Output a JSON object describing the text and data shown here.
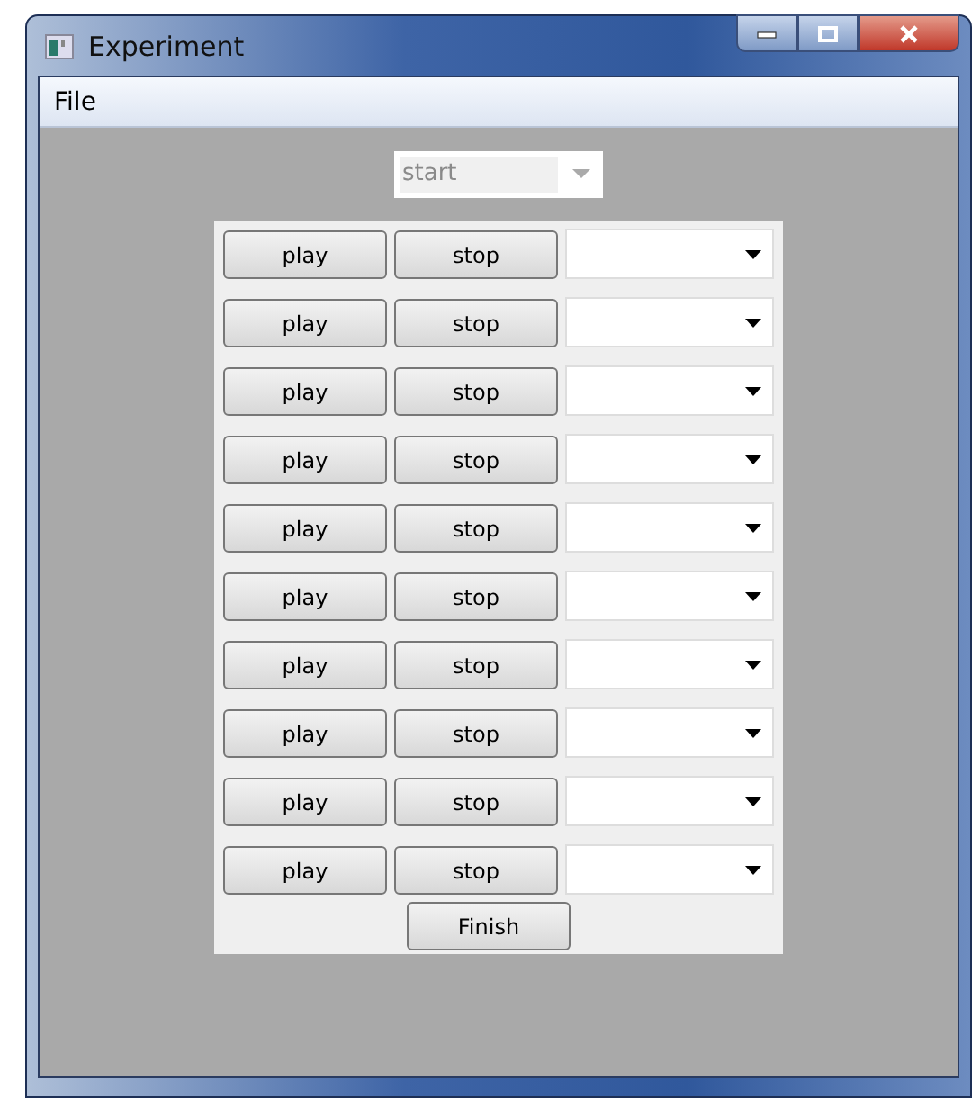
{
  "window": {
    "title": "Experiment"
  },
  "menu": [
    "File"
  ],
  "start_combo": {
    "value": "start",
    "disabled": true
  },
  "rows": [
    {
      "play": "play",
      "stop": "stop"
    },
    {
      "play": "play",
      "stop": "stop"
    },
    {
      "play": "play",
      "stop": "stop"
    },
    {
      "play": "play",
      "stop": "stop"
    },
    {
      "play": "play",
      "stop": "stop"
    },
    {
      "play": "play",
      "stop": "stop"
    },
    {
      "play": "play",
      "stop": "stop"
    },
    {
      "play": "play",
      "stop": "stop"
    },
    {
      "play": "play",
      "stop": "stop"
    },
    {
      "play": "play",
      "stop": "stop"
    }
  ],
  "finish_button": "Finish"
}
